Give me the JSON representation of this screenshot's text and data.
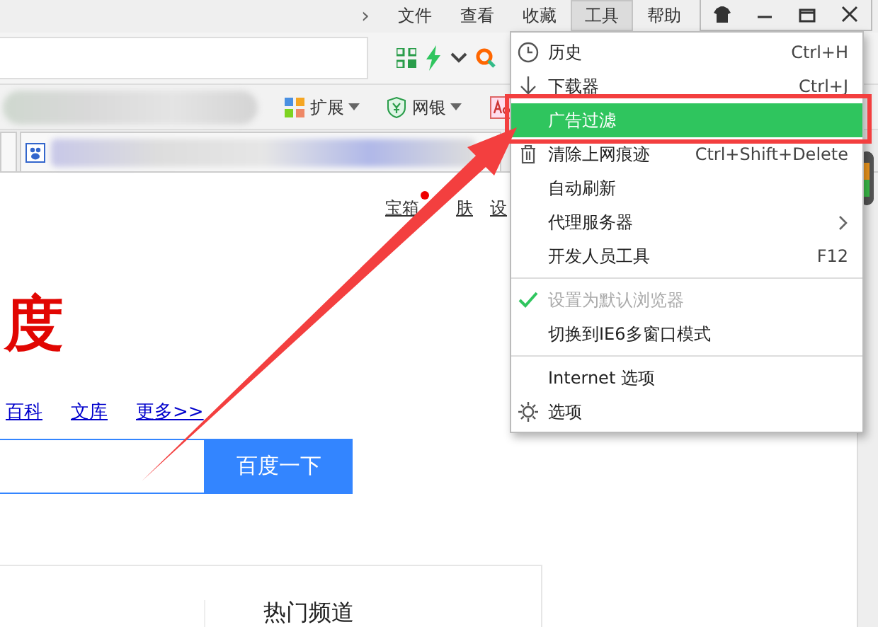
{
  "menu_bar": {
    "overflow": "›",
    "items": [
      {
        "label": "文件",
        "selected": false
      },
      {
        "label": "查看",
        "selected": false
      },
      {
        "label": "收藏",
        "selected": false
      },
      {
        "label": "工具",
        "selected": true
      },
      {
        "label": "帮助",
        "selected": false
      }
    ]
  },
  "toolbar": {
    "items": [
      {
        "label": "扩展",
        "dropdown": true
      },
      {
        "label": "网银",
        "dropdown": true
      }
    ]
  },
  "page": {
    "top_links": [
      {
        "label": "宝箱",
        "notification": true
      },
      {
        "label": "肤"
      },
      {
        "label": "设"
      }
    ],
    "logo": "度",
    "nav_links": [
      "百科",
      "文库",
      "更多>>"
    ],
    "search_button": "百度一下",
    "section_title": "热门频道"
  },
  "dropdown_menu": {
    "items": [
      {
        "kind": "item",
        "label": "历史",
        "shortcut": "Ctrl+H",
        "selected": false,
        "disabled": false,
        "checked": false,
        "submenu": false
      },
      {
        "kind": "item",
        "label": "下载器",
        "shortcut": "Ctrl+J",
        "selected": false,
        "disabled": false,
        "checked": false,
        "submenu": false
      },
      {
        "kind": "item",
        "label": "广告过滤",
        "selected": true,
        "disabled": false,
        "checked": false,
        "submenu": false
      },
      {
        "kind": "item",
        "label": "清除上网痕迹",
        "shortcut": "Ctrl+Shift+Delete",
        "selected": false,
        "disabled": false,
        "checked": false,
        "submenu": false
      },
      {
        "kind": "item",
        "label": "自动刷新",
        "selected": false,
        "disabled": false,
        "checked": false,
        "submenu": false
      },
      {
        "kind": "item",
        "label": "代理服务器",
        "selected": false,
        "disabled": false,
        "checked": false,
        "submenu": true
      },
      {
        "kind": "item",
        "label": "开发人员工具",
        "shortcut": "F12",
        "selected": false,
        "disabled": false,
        "checked": false,
        "submenu": false
      },
      {
        "kind": "separator"
      },
      {
        "kind": "item",
        "label": "设置为默认浏览器",
        "selected": false,
        "disabled": true,
        "checked": true,
        "submenu": false
      },
      {
        "kind": "item",
        "label": "切换到IE6多窗口模式",
        "selected": false,
        "disabled": false,
        "checked": false,
        "submenu": false
      },
      {
        "kind": "separator"
      },
      {
        "kind": "item",
        "label": "Internet 选项",
        "selected": false,
        "disabled": false,
        "checked": false,
        "submenu": false
      },
      {
        "kind": "item",
        "label": "选项",
        "selected": false,
        "disabled": false,
        "checked": false,
        "submenu": false
      }
    ]
  }
}
